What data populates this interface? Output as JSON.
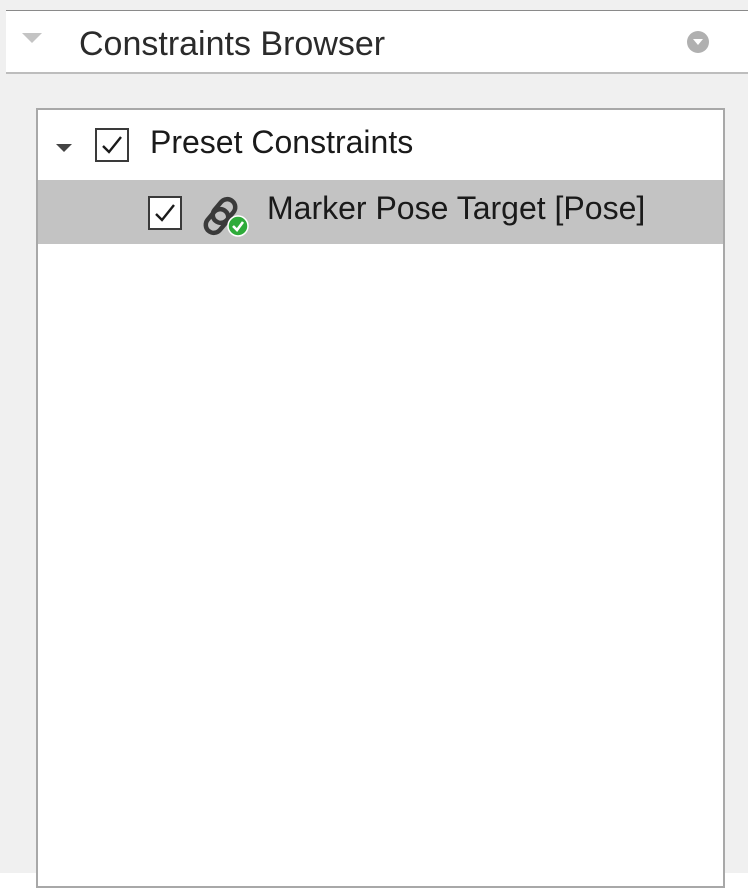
{
  "panel": {
    "title": "Constraints Browser",
    "collapse_icon": "triangle-down-icon",
    "menu_icon": "circle-chevron-down-icon"
  },
  "tree": {
    "items": [
      {
        "label": "Preset Constraints",
        "checked": true,
        "expanded": true,
        "children": [
          {
            "label": "Marker Pose Target [Pose]",
            "checked": true,
            "selected": true,
            "icon": "constraint-chain-active-icon"
          }
        ]
      }
    ]
  },
  "colors": {
    "selected_row": "#c3c3c3",
    "status_ok": "#2eab3a"
  }
}
